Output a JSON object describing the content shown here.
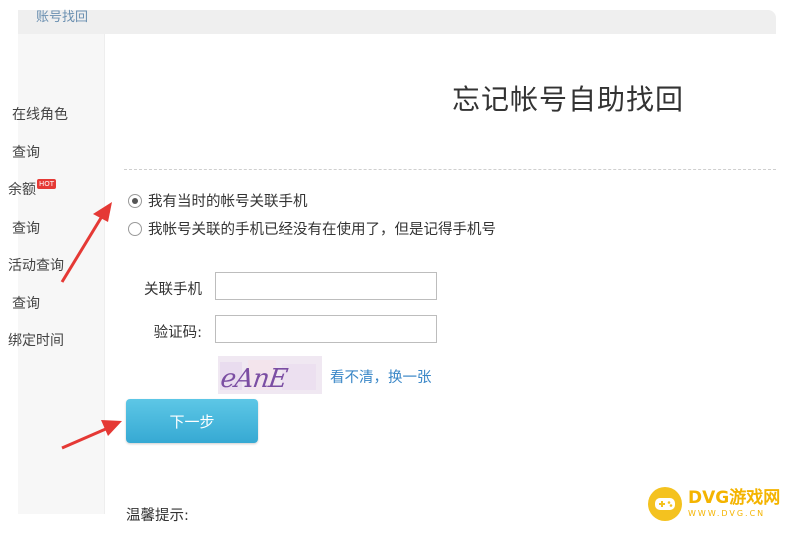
{
  "header": {
    "title": "账号找回"
  },
  "sidebar": {
    "items": [
      {
        "label": "在线角色"
      },
      {
        "label": "查询"
      },
      {
        "label": "余额",
        "badge": "HOT"
      },
      {
        "label": "查询"
      },
      {
        "label": "活动查询"
      },
      {
        "label": "查询"
      },
      {
        "label": "绑定时间"
      }
    ]
  },
  "main": {
    "title": "忘记帐号自助找回",
    "options": [
      {
        "label": "我有当时的帐号关联手机",
        "checked": true
      },
      {
        "label": "我帐号关联的手机已经没有在使用了，但是记得手机号",
        "checked": false
      }
    ],
    "phone_label": "关联手机",
    "phone_value": "",
    "captcha_label": "验证码:",
    "captcha_value": "",
    "captcha_text": "eAnE",
    "refresh_label": "看不清，换一张",
    "next_label": "下一步",
    "tips_label": "温馨提示:"
  },
  "watermark": {
    "brand": "DVG游戏网",
    "url": "WWW.DVG.CN"
  },
  "colors": {
    "accent": "#3aaad5",
    "link": "#3a87c7",
    "arrow": "#e53935",
    "watermark": "#f4b400"
  }
}
